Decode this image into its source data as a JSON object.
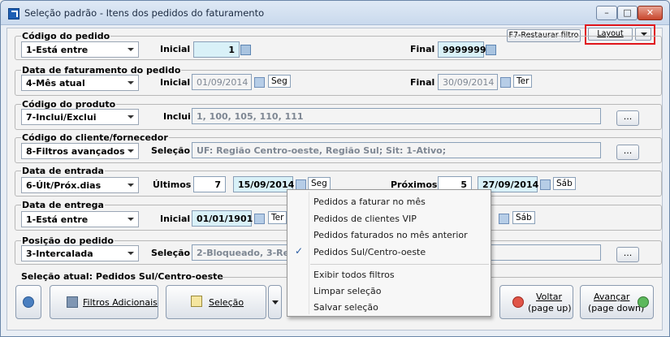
{
  "window": {
    "title": "Seleção padrão - Itens dos pedidos do faturamento",
    "restore_filter_label": "F7-Restaurar filtro",
    "layout_label": "Layout"
  },
  "groups": {
    "codigo_pedido": {
      "label": "Código do pedido",
      "combo": "1-Está entre",
      "inicial_label": "Inicial",
      "inicial_value": "1",
      "final_label": "Final",
      "final_value": "9999999"
    },
    "data_faturamento": {
      "label": "Data de faturamento do pedido",
      "combo": "4-Mês atual",
      "inicial_label": "Inicial",
      "inicial_value": "01/09/2014",
      "inicial_day": "Seg",
      "final_label": "Final",
      "final_value": "30/09/2014",
      "final_day": "Ter"
    },
    "codigo_produto": {
      "label": "Código do produto",
      "combo": "7-Inclui/Exclui",
      "inclui_label": "Inclui",
      "inclui_value": "1, 100, 105, 110, 111",
      "more": "..."
    },
    "codigo_cliente": {
      "label": "Código do cliente/fornecedor",
      "combo": "8-Filtros avançados",
      "selecao_label": "Seleção",
      "selecao_value": "UF: Região Centro-oeste, Região Sul; Sit: 1-Ativo;",
      "more": "..."
    },
    "data_entrada": {
      "label": "Data de entrada",
      "combo": "6-Últ/Próx.dias",
      "ultimos_label": "Últimos",
      "ultimos_value": "7",
      "ultimos_date": "15/09/2014",
      "ultimos_day": "Seg",
      "proximos_label": "Próximos",
      "proximos_value": "5",
      "proximos_date": "27/09/2014",
      "proximos_day": "Sáb"
    },
    "data_entrega": {
      "label": "Data de entrega",
      "combo": "1-Está entre",
      "inicial_label": "Inicial",
      "inicial_value": "01/01/1901",
      "inicial_day": "Ter",
      "final_day": "Sáb"
    },
    "posicao_pedido": {
      "label": "Posição do pedido",
      "combo": "3-Intercalada",
      "selecao_label": "Seleção",
      "selecao_value": "2-Bloqueado, 3-Recus",
      "more": "..."
    }
  },
  "selection": {
    "current": "Seleção atual: Pedidos Sul/Centro-oeste"
  },
  "buttons": {
    "filtros": "Filtros Adicionais",
    "selecao": "Seleção",
    "voltar_1": "Voltar",
    "voltar_2": "(page up)",
    "avancar_1": "Avançar",
    "avancar_2": "(page down)"
  },
  "menu": {
    "items": [
      "Pedidos a faturar no mês",
      "Pedidos de clientes VIP",
      "Pedidos faturados no mês anterior",
      "Pedidos Sul/Centro-oeste"
    ],
    "checked_index": 3,
    "check_glyph": "✓",
    "actions": [
      "Exibir todos filtros",
      "Limpar seleção",
      "Salvar seleção"
    ]
  }
}
